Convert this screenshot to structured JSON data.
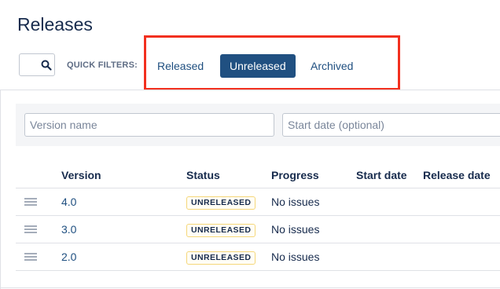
{
  "page": {
    "title": "Releases"
  },
  "filters": {
    "label": "QUICK FILTERS:",
    "items": [
      {
        "label": "Released",
        "active": false
      },
      {
        "label": "Unreleased",
        "active": true
      },
      {
        "label": "Archived",
        "active": false
      }
    ]
  },
  "form": {
    "version_placeholder": "Version name",
    "start_placeholder": "Start date (optional)"
  },
  "table": {
    "headers": [
      "Version",
      "Status",
      "Progress",
      "Start date",
      "Release date"
    ],
    "rows": [
      {
        "version": "4.0",
        "status": "UNRELEASED",
        "progress": "No issues"
      },
      {
        "version": "3.0",
        "status": "UNRELEASED",
        "progress": "No issues"
      },
      {
        "version": "2.0",
        "status": "UNRELEASED",
        "progress": "No issues"
      }
    ]
  },
  "colors": {
    "accent": "#205081",
    "highlight": "#f2301f",
    "lozenge_border": "#f5d77a"
  },
  "icons": {
    "search": "search-icon",
    "drag": "drag-handle-icon"
  }
}
